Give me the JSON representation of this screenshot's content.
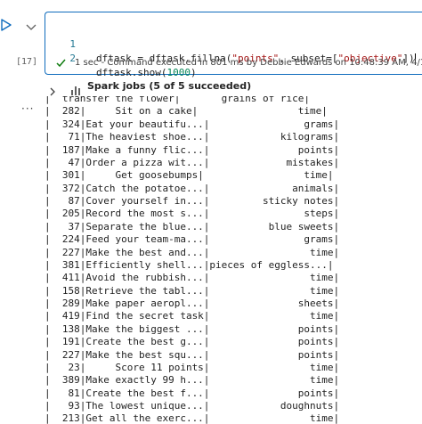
{
  "gutter": {
    "execution_count": "[17]"
  },
  "code": {
    "lines": [
      {
        "num": "1",
        "parts": {
          "a": "dftask = dftask.fillna(",
          "b": "\"points\"",
          "c": ", subset=[",
          "d": "\"objective\"",
          "e": "])"
        }
      },
      {
        "num": "2",
        "parts": {
          "a": "dftask.show(",
          "b": "1000",
          "c": ")"
        }
      }
    ]
  },
  "status": {
    "text": "1 sec - Command executed in 801 ms by Debbie Edwards on 10:48:39 AM, 4/16/24"
  },
  "spark_jobs": {
    "label": "Spark jobs (5 of 5 succeeded)"
  },
  "output": {
    "rows": [
      "|  transfer the flower|       grains of rice|",
      "|  282|     Sit on a cake|                 time|",
      "|  324|Eat your beautifu...|                grams|",
      "|   71|The heaviest shoe...|            kilograms|",
      "|  187|Make a funny flic...|               points|",
      "|   47|Order a pizza wit...|             mistakes|",
      "|  301|     Get goosebumps|                 time|",
      "|  372|Catch the potatoe...|              animals|",
      "|   87|Cover yourself in...|         sticky notes|",
      "|  205|Record the most s...|                steps|",
      "|   37|Separate the blue...|          blue sweets|",
      "|  224|Feed your team-ma...|                grams|",
      "|  227|Make the best and...|                 time|",
      "|  381|Efficiently shell...|pieces of eggless...|",
      "|  411|Avoid the rubbish...|                 time|",
      "|  158|Retrieve the tabl...|                 time|",
      "|  289|Make paper aeropl...|               sheets|",
      "|  419|Find the secret task|                 time|",
      "|  138|Make the biggest ...|               points|",
      "|  191|Create the best g...|               points|",
      "|  227|Make the best squ...|               points|",
      "|   23|     Score 11 points|                 time|",
      "|  389|Make exactly 99 h...|                 time|",
      "|   81|Create the best f...|               points|",
      "|   93|The lowest unique...|            doughnuts|",
      "|  213|Get all the exerc...|                 time|"
    ]
  },
  "colors": {
    "focus_border": "#0f6cbd",
    "success": "#107c10",
    "line_number": "#237893",
    "string": "#a31515",
    "number": "#098658"
  },
  "icons": {
    "run": "play-outline-icon",
    "collapse": "chevron-down-icon",
    "status": "checkmark-icon",
    "expand": "chevron-right-icon",
    "spark": "bar-chart-icon",
    "more": "more-horizontal-icon"
  }
}
